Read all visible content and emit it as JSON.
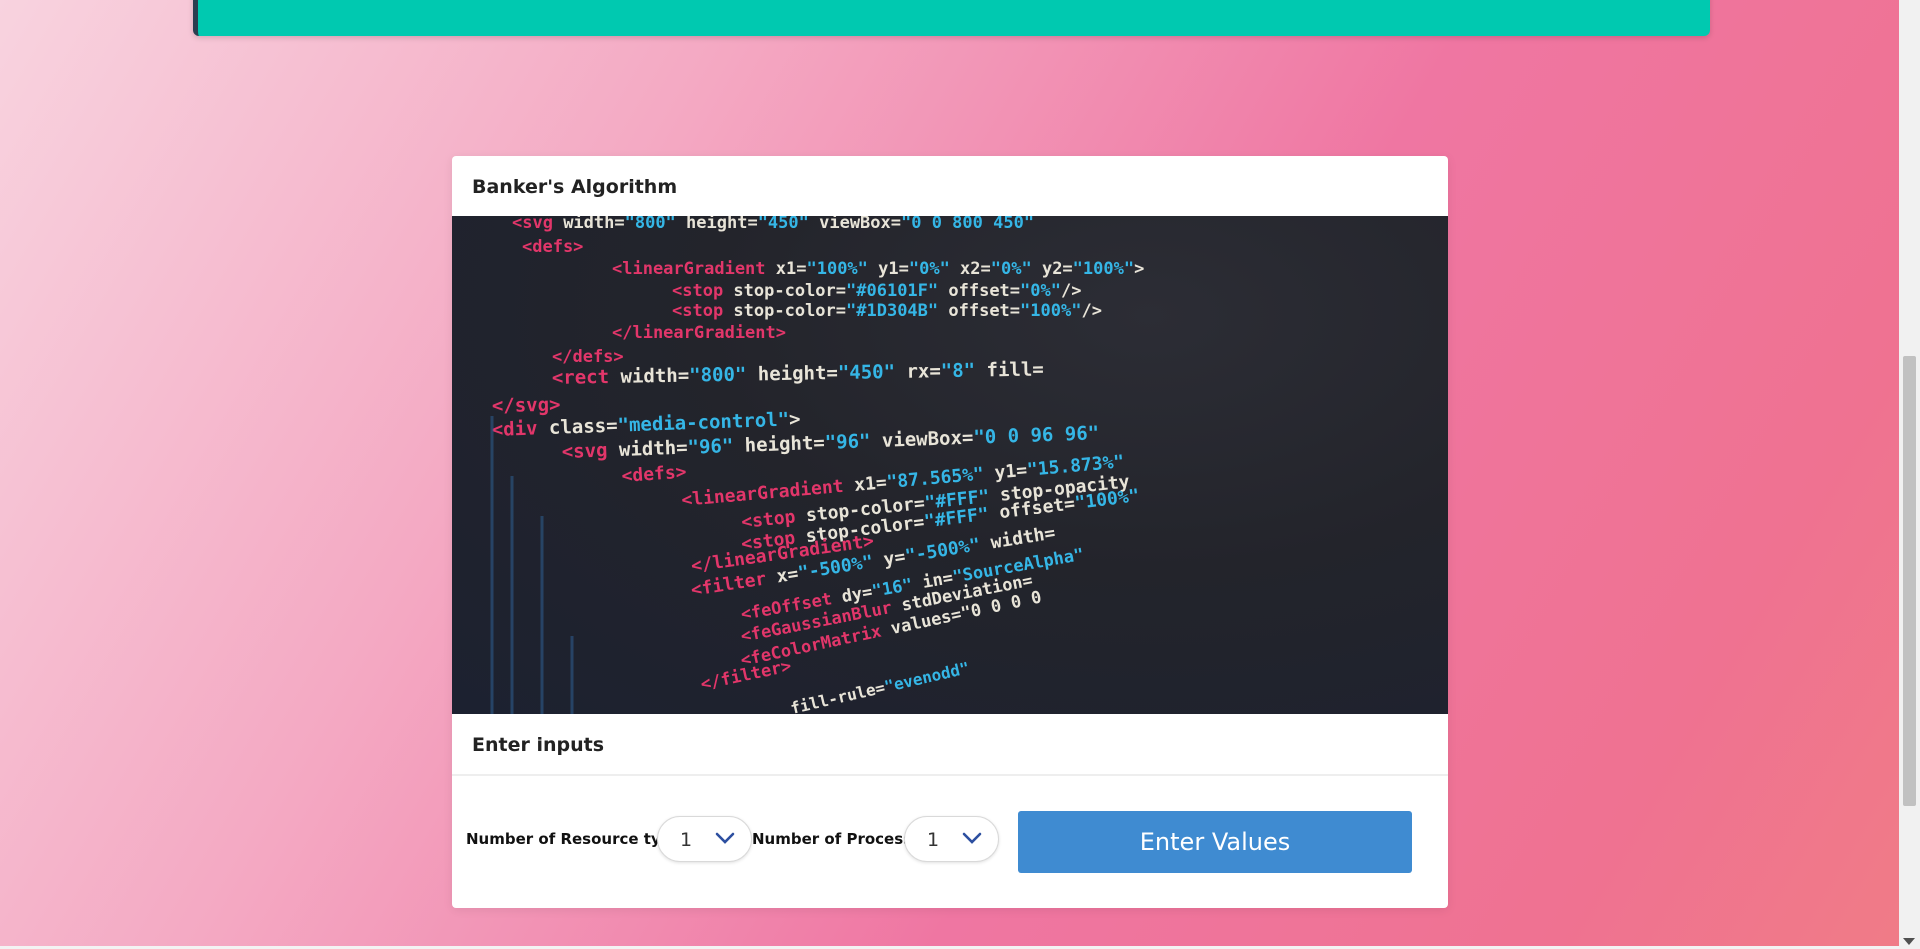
{
  "card": {
    "title": "Banker's Algorithm",
    "section_title": "Enter inputs"
  },
  "form": {
    "resource_types_label": "Number of Resource types:",
    "resource_types_value": "1",
    "processes_label": "Number of Processes:",
    "processes_value": "1",
    "enter_button_label": "Enter Values"
  },
  "code_image": {
    "lines": [
      "<svg width=\"800\" height=\"450\" viewBox=\"0 0 800 450\"",
      "<defs>",
      "<linearGradient x1=\"100%\" y1=\"0%\" x2=\"0%\" y2=\"100%\">",
      "<stop stop-color=\"#06101F\" offset=\"0%\"/>",
      "<stop stop-color=\"#1D304B\" offset=\"100%\"/>",
      "</linearGradient>",
      "</defs>",
      "<rect width=\"800\" height=\"450\" rx=\"8\" fill=",
      "</svg>",
      "<div class=\"media-control\">",
      "<svg width=\"96\" height=\"96\" viewBox=\"0 0 96 96\"",
      "<defs>",
      "<linearGradient x1=\"87.565%\" y1=\"15.873%\"",
      "<stop stop-color=\"#FFF\" stop-opacity",
      "<stop stop-color=\"#FFF\" offset=\"100%\"",
      "</linearGradient>",
      "<filter x=\"-500%\" y=\"-500%\" width=",
      "<feOffset dy=\"16\" in=\"SourceAlpha\"",
      "<feGaussianBlur stdDeviation=",
      "<feColorMatrix values=\"0 0 0 0",
      "</filter>",
      "fill-rule=\"evenodd\""
    ]
  },
  "colors": {
    "banner": "#00c9b0",
    "button": "#3f8bd1",
    "tag": "#e2366a",
    "attr": "#e8e4d8",
    "string": "#35b6e6"
  }
}
